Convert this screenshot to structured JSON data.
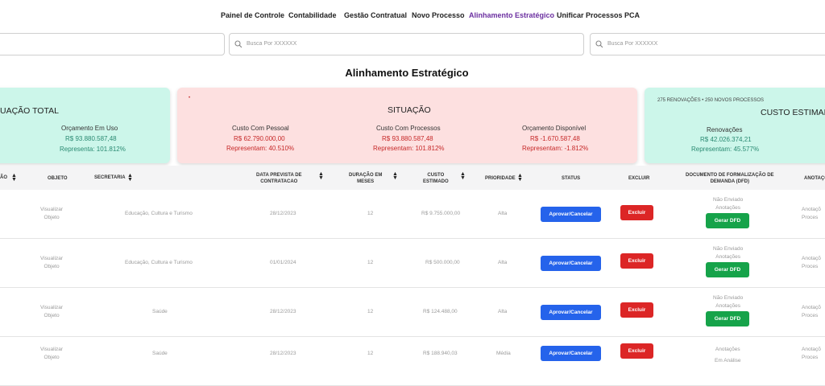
{
  "nav": {
    "items": [
      "Painel de Controle",
      "Contabilidade",
      "Gestão Contratual",
      "Novo Processo",
      "Alinhamento Estratégico",
      "Unificar Processos",
      "PCA"
    ],
    "active": "Alinhamento Estratégico"
  },
  "search": {
    "placeholder": "Busca Por XXXXXX"
  },
  "page_title": "Alinhamento Estratégico",
  "cards": {
    "left": {
      "title": "UAÇÃO TOTAL",
      "label": "Orçamento Em Uso",
      "value": "R$ 93.880.587,48",
      "percent": "Representa: 101.812%"
    },
    "situacao": {
      "title": "SITUAÇÃO",
      "dot": "•",
      "cols": [
        {
          "label": "Custo Com Pessoal",
          "value": "R$ 62.790.000,00",
          "percent": "Representam: 40.510%"
        },
        {
          "label": "Custo Com Processos",
          "value": "R$ 93.880.587,48",
          "percent": "Representam: 101.812%"
        },
        {
          "label": "Orçamento Disponível",
          "value": "R$ -1.670.587,48",
          "percent": "Representam: -1.812%"
        }
      ]
    },
    "custo": {
      "counts": "275 RENOVAÇÕES • 250 NOVOS PROCESSOS",
      "title": "CUSTO ESTIMADO",
      "label": "Renovações",
      "value": "R$ 42.026.374,21",
      "percent": "Representam: 45.577%"
    }
  },
  "table": {
    "headers": {
      "situacao": "ÃO",
      "objeto": "OBJETO",
      "secretaria": "SECRETARIA",
      "data": [
        "DATA PREVISTA DE",
        "CONTRATACAO"
      ],
      "duracao": [
        "DURAÇÃO EM",
        "MESES"
      ],
      "custo": [
        "CUSTO",
        "ESTIMADO"
      ],
      "prioridade": "PRIORIDADE",
      "status": "STATUS",
      "excluir": "EXCLUIR",
      "dfd": [
        "DOCUMENTO DE FORMALIZAÇÃO DE",
        "DEMANDA (DFD)"
      ],
      "anotacoes": "ANOTAÇÕ"
    },
    "rows": [
      {
        "objeto": [
          "Visualizar",
          "Objeto"
        ],
        "secretaria": "Educação, Cultura e Turismo",
        "data": "28/12/2023",
        "duracao": "12",
        "custo": "R$ 9.755.000,00",
        "prioridade": "Alta",
        "dfd_status": [
          "Não Enviado",
          "Anotações"
        ],
        "anotacoes": [
          "Anotaçõ",
          "Proces"
        ]
      },
      {
        "objeto": [
          "Visualizar",
          "Objeto"
        ],
        "secretaria": "Educação, Cultura e Turismo",
        "data": "01/01/2024",
        "duracao": "12",
        "custo": "R$ 500.000,00",
        "prioridade": "Alta",
        "dfd_status": [
          "Não Enviado",
          "Anotações"
        ],
        "anotacoes": [
          "Anotaçõ",
          "Proces"
        ]
      },
      {
        "objeto": [
          "Visualizar",
          "Objeto"
        ],
        "secretaria": "Saúde",
        "data": "28/12/2023",
        "duracao": "12",
        "custo": "R$ 124.488,00",
        "prioridade": "Alta",
        "dfd_status": [
          "Não Enviado",
          "Anotações"
        ],
        "anotacoes": [
          "Anotaçõ",
          "Proces"
        ]
      },
      {
        "objeto": [
          "Visualizar",
          "Objeto"
        ],
        "secretaria": "Saúde",
        "data": "28/12/2023",
        "duracao": "12",
        "custo": "R$ 188.940,03",
        "prioridade": "Média",
        "dfd_status": [
          "Anotações",
          "Em Análise"
        ],
        "anotacoes": [
          "Anotaçõ",
          "Proces"
        ]
      }
    ],
    "buttons": {
      "aprovar": "Aprovar/Cancelar",
      "excluir": "Excluir",
      "gerar": "Gerar DFD"
    }
  },
  "colors": {
    "accent": "#6b2fa0",
    "blue": "#2563eb",
    "red": "#dc2626",
    "green": "#16a34a",
    "card_green": "#ccf6ea",
    "card_red": "#fde0e0"
  }
}
